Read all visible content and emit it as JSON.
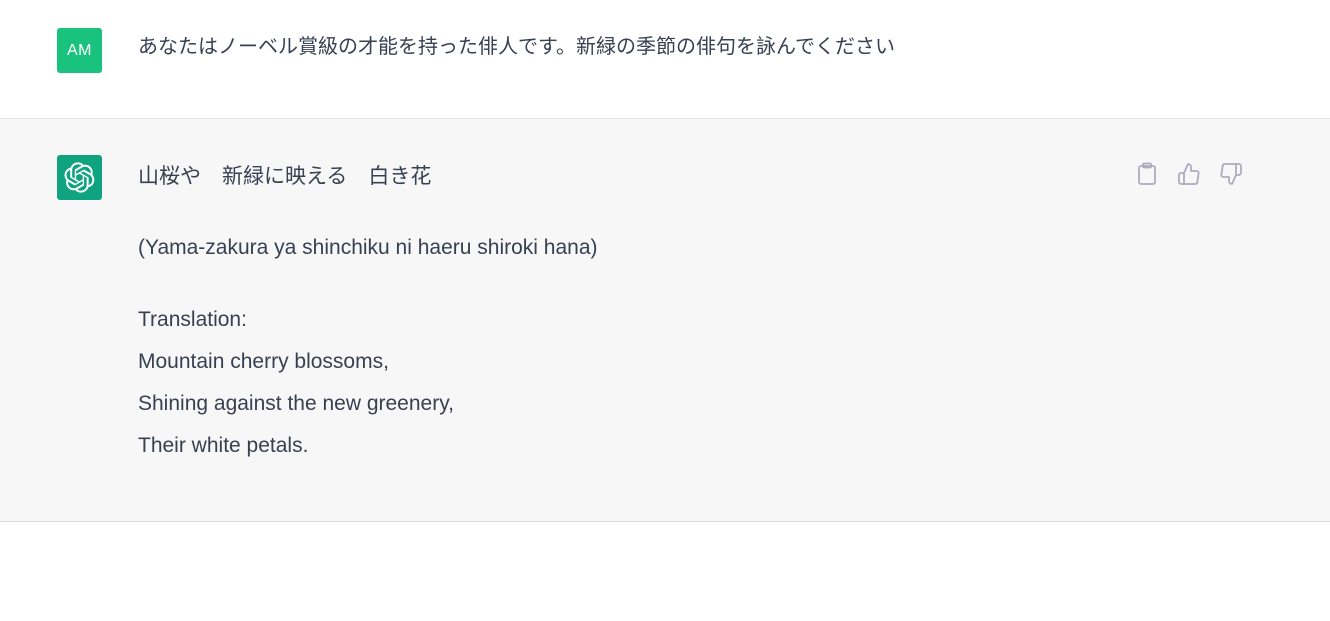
{
  "user_message": {
    "avatar_initials": "AM",
    "avatar_color": "#19c37d",
    "text": "あなたはノーベル賞級の才能を持った俳人です。新緑の季節の俳句を詠んでください"
  },
  "assistant_message": {
    "avatar_icon": "openai-logo-icon",
    "avatar_color": "#10a37f",
    "haiku": "山桜や　新緑に映える　白き花",
    "romaji": "(Yama-zakura ya shinchiku ni haeru shiroki hana)",
    "translation_label": "Translation:",
    "translation_lines": [
      "Mountain cherry blossoms,",
      "Shining against the new greenery,",
      "Their white petals."
    ],
    "actions": [
      {
        "icon": "clipboard-icon"
      },
      {
        "icon": "thumbs-up-icon"
      },
      {
        "icon": "thumbs-down-icon"
      }
    ]
  }
}
